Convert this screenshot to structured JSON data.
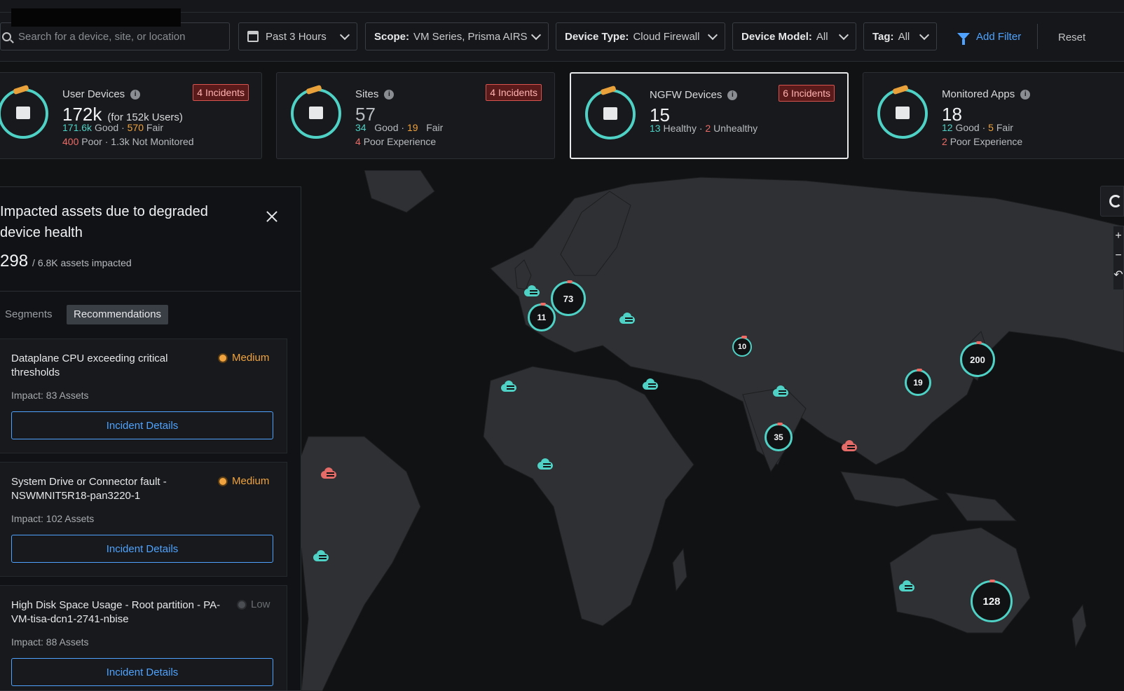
{
  "filters": {
    "search_placeholder": "Search for a device, site, or location",
    "time": "Past 3 Hours",
    "scope_label": "Scope:",
    "scope_value": "VM Series, Prisma AIRS",
    "device_type_label": "Device Type:",
    "device_type_value": "Cloud Firewall",
    "device_model_label": "Device Model:",
    "device_model_value": "All",
    "tag_label": "Tag:",
    "tag_value": "All",
    "add_filter": "Add Filter",
    "reset": "Reset"
  },
  "cards": {
    "user_devices": {
      "title": "User Devices",
      "incidents": "4 Incidents",
      "value": "172k",
      "sub": "(for 152k Users)",
      "good_n": "171.6k",
      "good": "Good",
      "fair_n": "570",
      "fair": "Fair",
      "poor_n": "400",
      "poor": "Poor",
      "nm_n": "1.3k",
      "nm": "Not Monitored"
    },
    "sites": {
      "title": "Sites",
      "incidents": "4 Incidents",
      "value": "57",
      "good_n": "34",
      "good": "Good",
      "fair_n": "19",
      "fair": "Fair",
      "poor_n": "4",
      "poor": "Poor Experience"
    },
    "ngfw": {
      "title": "NGFW Devices",
      "incidents": "6 Incidents",
      "value": "15",
      "healthy_n": "13",
      "healthy": "Healthy",
      "unhealthy_n": "2",
      "unhealthy": "Unhealthy"
    },
    "apps": {
      "title": "Monitored Apps",
      "value": "18",
      "good_n": "12",
      "good": "Good",
      "fair_n": "5",
      "fair": "Fair",
      "poor_n": "2",
      "poor": "Poor Experience"
    }
  },
  "panel": {
    "title": "Impacted assets due to degraded device health",
    "count": "298",
    "count_sub": "/ 6.8K assets impacted",
    "tabs": [
      "Segments",
      "Recommendations"
    ],
    "recommendations": [
      {
        "title": "Dataplane CPU exceeding critical thresholds",
        "severity": "Medium",
        "impact_label": "Impact:",
        "impact": "83 Assets",
        "button": "Incident Details"
      },
      {
        "title": "System Drive or Connector fault - NSWMNIT5R18-pan3220-1",
        "severity": "Medium",
        "impact_label": "Impact:",
        "impact": "102 Assets",
        "button": "Incident Details"
      },
      {
        "title": "High Disk Space Usage - Root partition - PA-VM-tisa-dcn1-2741-nbise",
        "severity": "Low",
        "impact_label": "Impact:",
        "impact": "88 Assets",
        "button": "Incident Details"
      }
    ]
  },
  "map_clusters": [
    "73",
    "11",
    "10",
    "200",
    "19",
    "35",
    "128"
  ],
  "zoom_controls": {
    "in": "+",
    "out": "−"
  },
  "colors": {
    "healthy": "#4fd1c5",
    "warning": "#f0a33e",
    "critical": "#ef6b66",
    "accent": "#4fa3ff"
  }
}
